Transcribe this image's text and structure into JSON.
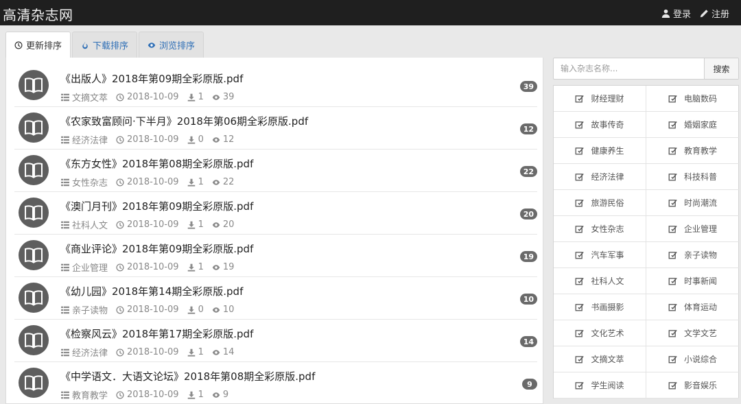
{
  "navbar": {
    "brand": "高清杂志网",
    "login": "登录",
    "register": "注册"
  },
  "tabs": [
    {
      "label": "更新排序",
      "icon": "clock-icon",
      "active": true
    },
    {
      "label": "下载排序",
      "icon": "fire-icon",
      "active": false
    },
    {
      "label": "浏览排序",
      "icon": "eye-icon",
      "active": false
    }
  ],
  "items": [
    {
      "title": "《出版人》2018年第09期全彩原版.pdf",
      "category": "文摘文萃",
      "date": "2018-10-09",
      "downloads": "1",
      "views": "39",
      "badge": "39"
    },
    {
      "title": "《农家致富顾问·下半月》2018年第06期全彩原版.pdf",
      "category": "经济法律",
      "date": "2018-10-09",
      "downloads": "0",
      "views": "12",
      "badge": "12"
    },
    {
      "title": "《东方女性》2018年第08期全彩原版.pdf",
      "category": "女性杂志",
      "date": "2018-10-09",
      "downloads": "1",
      "views": "22",
      "badge": "22"
    },
    {
      "title": "《澳门月刊》2018年第09期全彩原版.pdf",
      "category": "社科人文",
      "date": "2018-10-09",
      "downloads": "1",
      "views": "20",
      "badge": "20"
    },
    {
      "title": "《商业评论》2018年第09期全彩原版.pdf",
      "category": "企业管理",
      "date": "2018-10-09",
      "downloads": "1",
      "views": "19",
      "badge": "19"
    },
    {
      "title": "《幼儿园》2018年第14期全彩原版.pdf",
      "category": "亲子读物",
      "date": "2018-10-09",
      "downloads": "0",
      "views": "10",
      "badge": "10"
    },
    {
      "title": "《检察风云》2018年第17期全彩原版.pdf",
      "category": "经济法律",
      "date": "2018-10-09",
      "downloads": "1",
      "views": "14",
      "badge": "14"
    },
    {
      "title": "《中学语文．大语文论坛》2018年第08期全彩原版.pdf",
      "category": "教育教学",
      "date": "2018-10-09",
      "downloads": "1",
      "views": "9",
      "badge": "9"
    }
  ],
  "search": {
    "placeholder": "输入杂志名称...",
    "button": "搜索"
  },
  "categories": [
    "财经理财",
    "电脑数码",
    "故事传奇",
    "婚姻家庭",
    "健康养生",
    "教育教学",
    "经济法律",
    "科技科普",
    "旅游民俗",
    "时尚潮流",
    "女性杂志",
    "企业管理",
    "汽车军事",
    "亲子读物",
    "社科人文",
    "时事新闻",
    "书画摄影",
    "体育运动",
    "文化艺术",
    "文学文艺",
    "文摘文萃",
    "小说综合",
    "学生阅读",
    "影音娱乐"
  ],
  "colors": {
    "navbar": "#1f1f1f",
    "link": "#2f6fb6",
    "badge": "#6a6a6a",
    "icon_circle": "#5e5e5e"
  }
}
